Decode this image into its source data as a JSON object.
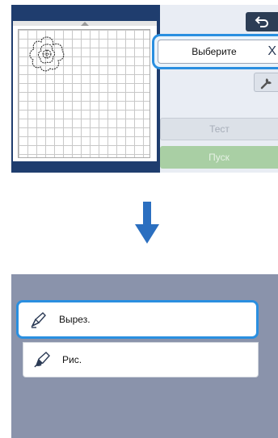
{
  "colors": {
    "top_screen_bg": "#1f3d6e",
    "highlight": "#2a8fe0",
    "start_button": "#a9cfa4",
    "bottom_screen_bg": "#8a93ab",
    "arrow": "#2b6fc0"
  },
  "top_screen": {
    "mat": {
      "pattern": "flower-outline"
    },
    "back_button": {
      "icon": "back-arrow-icon"
    },
    "select_button": {
      "label": "Выберите",
      "icon": "close-icon",
      "icon_glyph": "X"
    },
    "settings_button": {
      "icon": "wrench-icon"
    },
    "test_button": {
      "label": "Тест",
      "enabled": false
    },
    "start_button": {
      "label": "Пуск",
      "enabled": false
    }
  },
  "transition_arrow": {
    "icon": "arrow-down-icon"
  },
  "bottom_screen": {
    "menu_items": [
      {
        "label": "Вырез.",
        "icon": "blade-holder-icon",
        "selected": true
      },
      {
        "label": "Рис.",
        "icon": "pen-holder-icon",
        "selected": false
      }
    ]
  }
}
